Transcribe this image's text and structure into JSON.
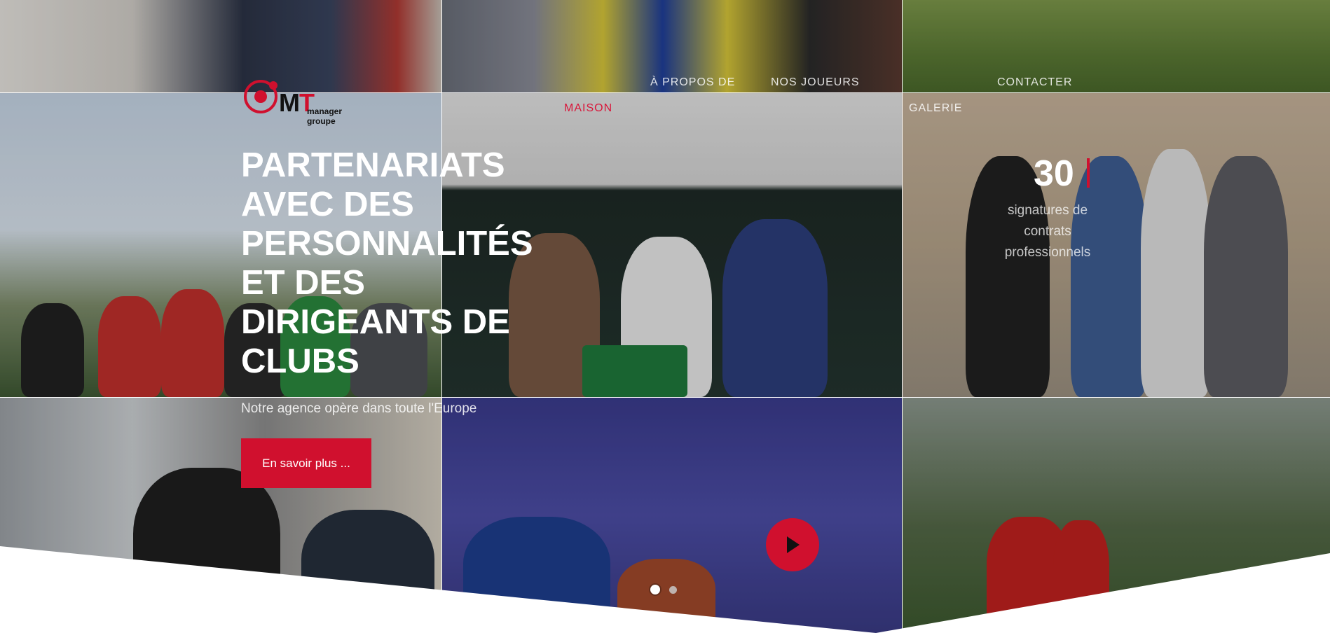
{
  "brand": {
    "logo_mark": "MT",
    "logo_subtitle": "manager groupe",
    "accent_color": "#d0102e"
  },
  "nav": {
    "items": [
      {
        "label": "À PROPOS DE"
      },
      {
        "label": "NOS JOUEURS"
      },
      {
        "label": "CONTACTER"
      },
      {
        "label": "MAISON"
      },
      {
        "label": "GALERIE"
      }
    ],
    "active_index": 3
  },
  "hero": {
    "headline": "PARTENARIATS AVEC DES PERSONNALITÉS ET DES DIRIGEANTS DE CLUBS",
    "subtitle": "Notre agence opère dans toute l'Europe",
    "cta_label": "En savoir plus ..."
  },
  "stat": {
    "number": "30",
    "label": "signatures de contrats professionnels"
  },
  "media": {
    "play_icon": "play-icon"
  },
  "slider": {
    "slide_count": 2,
    "active_slide": 1
  }
}
